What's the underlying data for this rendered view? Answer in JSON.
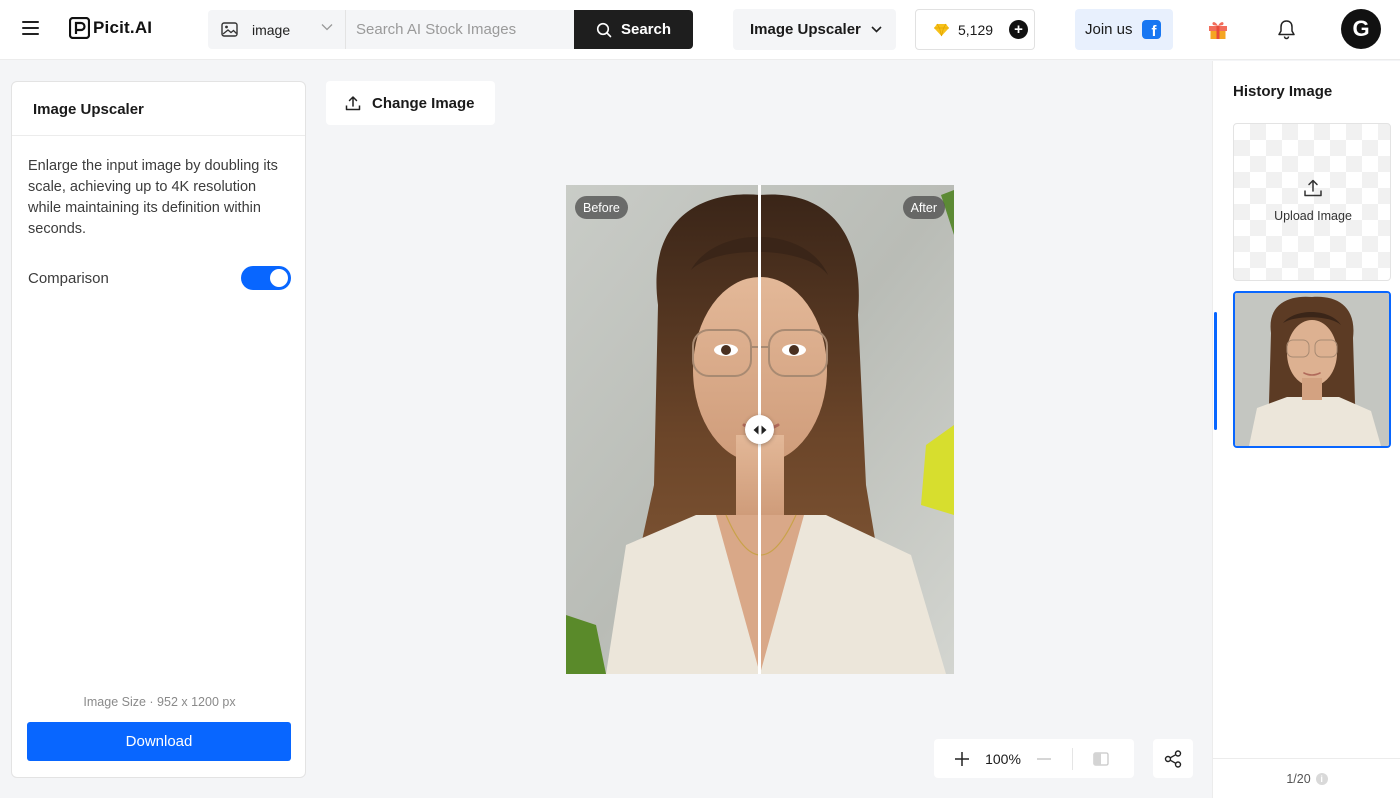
{
  "header": {
    "brand": "Picit.AI",
    "search_type": "image",
    "search_placeholder": "Search AI Stock Images",
    "search_button": "Search",
    "tool_select": "Image Upscaler",
    "credits": "5,129",
    "join_label": "Join us",
    "avatar_letter": "G",
    "icons": [
      "menu-icon",
      "image-icon",
      "chevron-down-icon",
      "search-icon",
      "gem-icon",
      "plus-icon",
      "facebook-icon",
      "gift-icon",
      "bell-icon"
    ]
  },
  "left_panel": {
    "title": "Image Upscaler",
    "description": "Enlarge the input image by doubling its scale, achieving up to 4K resolution while maintaining its definition within seconds.",
    "comparison_label": "Comparison",
    "comparison_enabled": true,
    "image_size": "Image Size · 952 x 1200 px",
    "download_label": "Download"
  },
  "canvas": {
    "change_image_label": "Change Image",
    "before_label": "Before",
    "after_label": "After",
    "zoom": "100%"
  },
  "right_panel": {
    "title": "History Image",
    "upload_label": "Upload Image",
    "pager": "1/20"
  },
  "colors": {
    "accent": "#0866ff",
    "dark_button": "#1e1e1e",
    "background": "#f4f5f7"
  }
}
